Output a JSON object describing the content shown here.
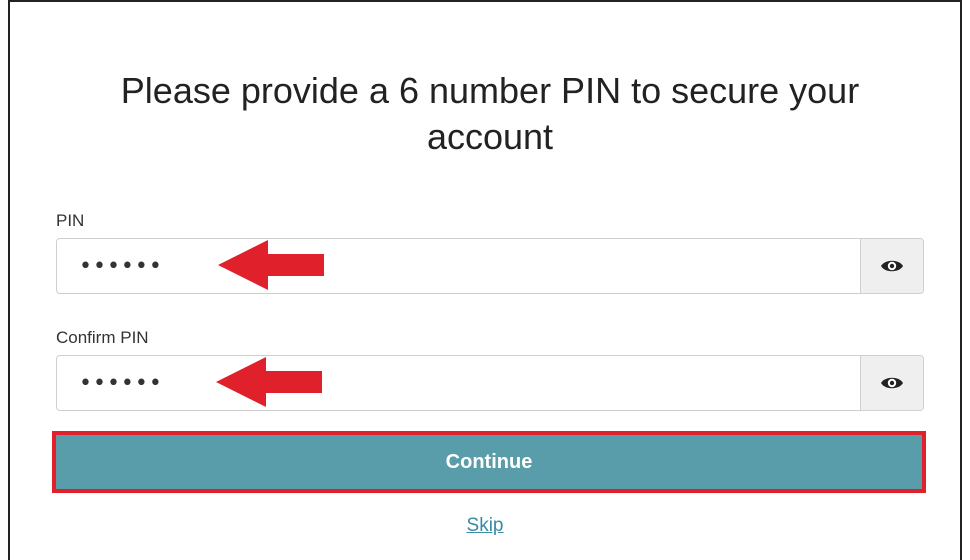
{
  "title": "Please provide a 6 number PIN to secure your account",
  "pin": {
    "label": "PIN",
    "value": "••••••",
    "toggle_icon": "eye-icon"
  },
  "confirm_pin": {
    "label": "Confirm PIN",
    "value": "••••••",
    "toggle_icon": "eye-icon"
  },
  "continue_label": "Continue",
  "skip_label": "Skip",
  "colors": {
    "button": "#5a9daa",
    "highlight": "#e0202a",
    "arrow": "#e0202a",
    "link": "#3a8aa6"
  }
}
